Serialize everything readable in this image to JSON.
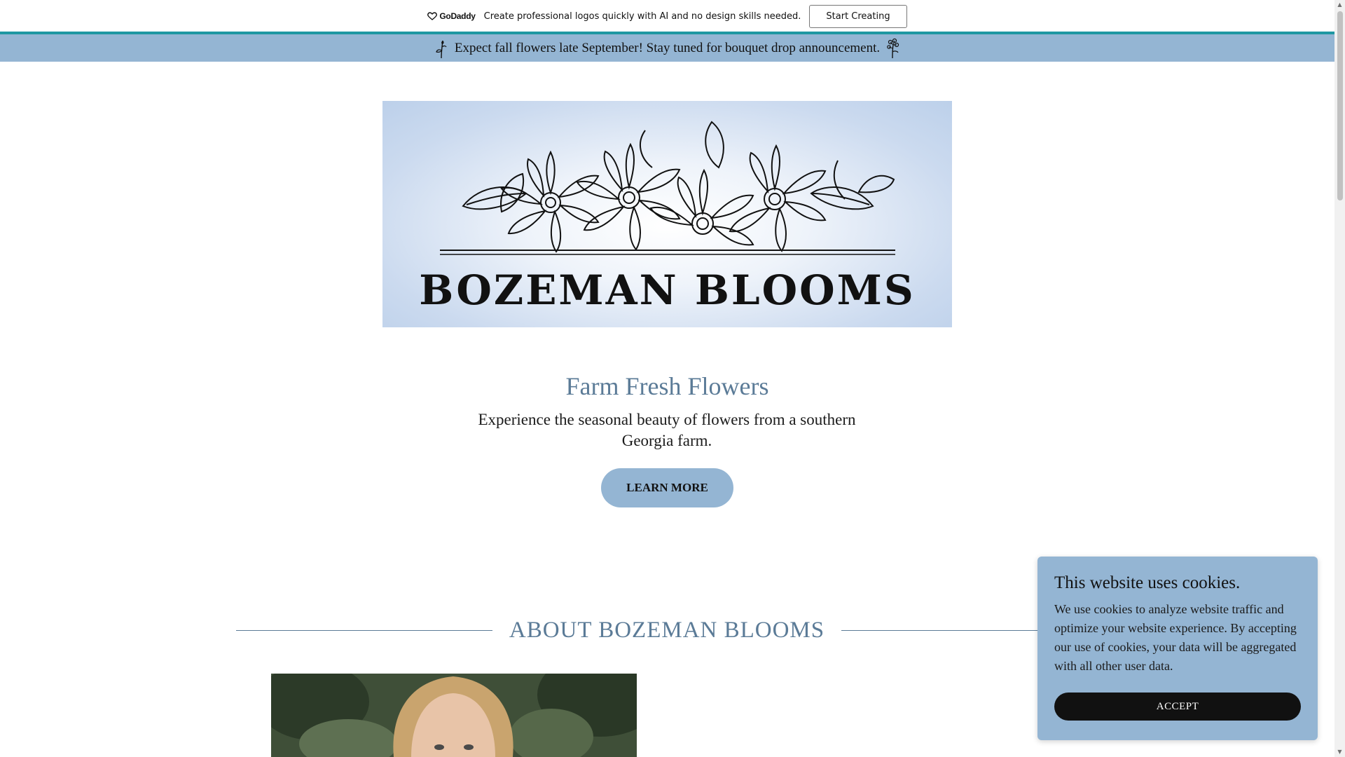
{
  "promo": {
    "logo_text": "GoDaddy",
    "message": "Create professional logos quickly with AI and no design skills needed.",
    "button_label": "Start Creating"
  },
  "announcement": {
    "text": "Expect fall flowers late September! Stay tuned for bouquet drop announcement.",
    "left_icon": "flower-sprig-icon",
    "right_icon": "flower-bunch-icon"
  },
  "hero": {
    "logo_wordmark": "BOZEMAN BLOOMS",
    "title": "Farm Fresh Flowers",
    "subtitle": "Experience the seasonal beauty of flowers from a southern Georgia farm.",
    "cta_label": "LEARN MORE"
  },
  "about": {
    "heading": "ABOUT BOZEMAN BLOOMS"
  },
  "cookie": {
    "title": "This website uses cookies.",
    "body": "We use cookies to analyze website traffic and optimize your website experience. By accepting our use of cookies, your data will be aggregated with all other user data.",
    "accept_label": "ACCEPT"
  },
  "colors": {
    "accent_blue": "#94b5d3",
    "heading_blue": "#5b7b97",
    "teal_line": "#1f97a2",
    "dark": "#111111"
  }
}
